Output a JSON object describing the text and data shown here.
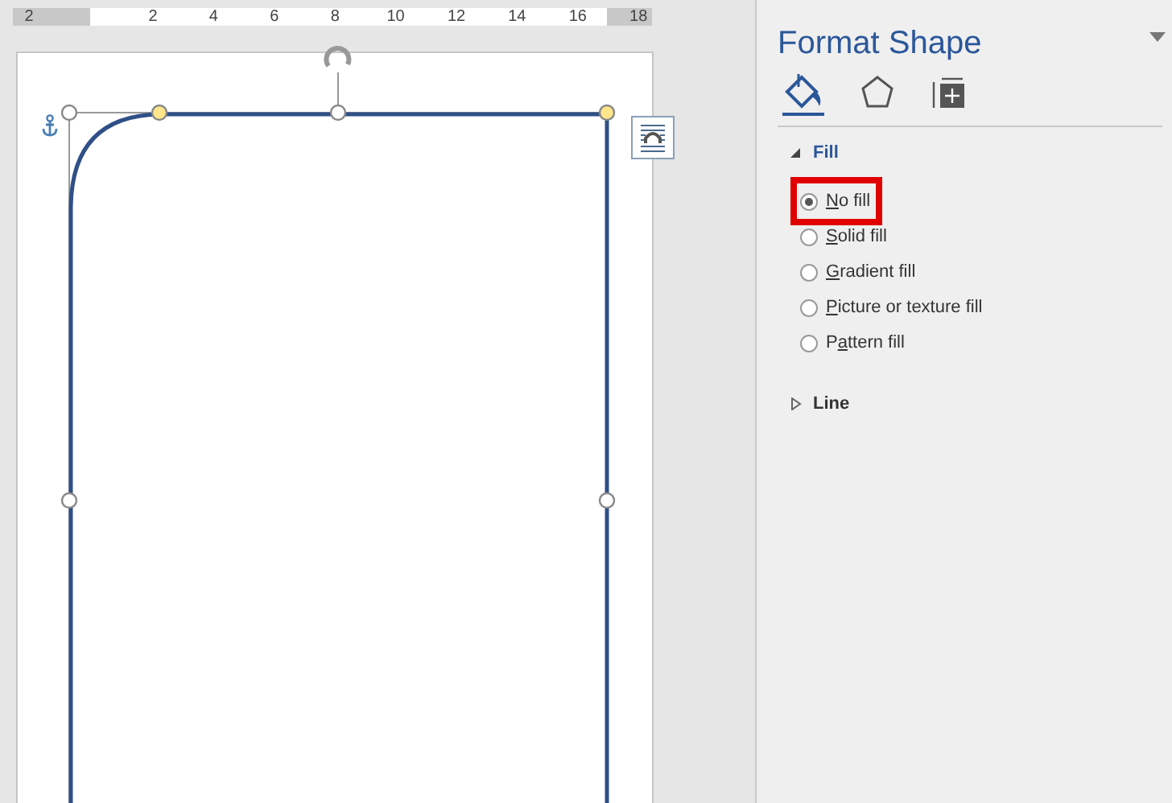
{
  "ruler": {
    "labels": [
      "2",
      "2",
      "4",
      "6",
      "8",
      "10",
      "12",
      "14",
      "16",
      "18"
    ]
  },
  "pane": {
    "title": "Format Shape",
    "tabs": [
      {
        "kind": "fill",
        "selected": true
      },
      {
        "kind": "effects",
        "selected": false
      },
      {
        "kind": "size",
        "selected": false
      }
    ],
    "sections": [
      {
        "label": "Fill",
        "expanded": true,
        "options": [
          {
            "label_parts": [
              {
                "text": "N",
                "underlined": true
              },
              {
                "text": "o fill",
                "underlined": false
              }
            ],
            "selected": true,
            "highlighted": true
          },
          {
            "label_parts": [
              {
                "text": "S",
                "underlined": true
              },
              {
                "text": "olid fill",
                "underlined": false
              }
            ],
            "selected": false,
            "highlighted": false
          },
          {
            "label_parts": [
              {
                "text": "G",
                "underlined": true
              },
              {
                "text": "radient fill",
                "underlined": false
              }
            ],
            "selected": false,
            "highlighted": false
          },
          {
            "label_parts": [
              {
                "text": "P",
                "underlined": true
              },
              {
                "text": "icture or texture fill",
                "underlined": false
              }
            ],
            "selected": false,
            "highlighted": false
          },
          {
            "label_parts": [
              {
                "text": "P",
                "underlined": false
              },
              {
                "text": "a",
                "underlined": true
              },
              {
                "text": "ttern fill",
                "underlined": false
              }
            ],
            "selected": false,
            "highlighted": false
          }
        ]
      },
      {
        "label": "Line",
        "expanded": false
      }
    ]
  }
}
